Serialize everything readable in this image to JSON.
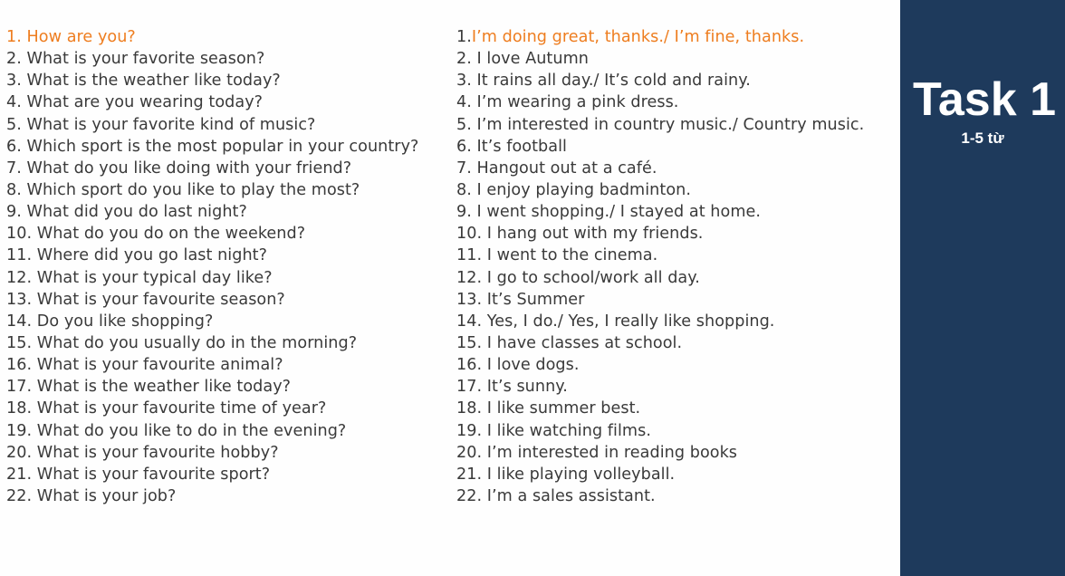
{
  "colors": {
    "highlight": "#ee7d1f",
    "text": "#3a3a3a",
    "panel": "#1e3a5c"
  },
  "panel": {
    "title": "Task 1",
    "subtitle": "1-5 từ"
  },
  "qa": [
    {
      "q": "1. How are you?",
      "a_num": "1.",
      "a": "I’m doing great, thanks./ I’m fine, thanks."
    },
    {
      "q": "2. What is your favorite season?",
      "a_num": "2. ",
      "a": "I love Autumn"
    },
    {
      "q": "3. What is the weather like today?",
      "a_num": "3. ",
      "a": "It rains all day./ It’s cold and rainy."
    },
    {
      "q": "4. What are you wearing today?",
      "a_num": "4. ",
      "a": "I’m wearing a pink dress."
    },
    {
      "q": "5. What is your favorite kind of music?",
      "a_num": "5. ",
      "a": "I’m interested in country music./ Country music."
    },
    {
      "q": "6. Which sport is the most popular in your country?",
      "a_num": "6. ",
      "a": "It’s football"
    },
    {
      "q": "7. What do you like doing with your friend?",
      "a_num": "7. ",
      "a": "Hangout out at a café."
    },
    {
      "q": "8. Which sport do you like to play the most?",
      "a_num": "8. ",
      "a": "I enjoy playing badminton."
    },
    {
      "q": "9. What did you do last night?",
      "a_num": "9. ",
      "a": "I went shopping./ I stayed at home."
    },
    {
      "q": "10. What do you do on the weekend?",
      "a_num": "10. ",
      "a": "I hang out with my friends."
    },
    {
      "q": "11. Where did you go last night?",
      "a_num": "11. ",
      "a": "I went to the cinema."
    },
    {
      "q": "12. What is your typical day like?",
      "a_num": "12. ",
      "a": "I go to school/work all day."
    },
    {
      "q": "13. What is your favourite season?",
      "a_num": "13. ",
      "a": "It’s Summer"
    },
    {
      "q": "14. Do you like shopping?",
      "a_num": "14. ",
      "a": "Yes, I do./ Yes, I really like shopping."
    },
    {
      "q": "15. What do you usually do in the morning?",
      "a_num": "15. ",
      "a": "I have classes at school."
    },
    {
      "q": "16. What is your favourite animal?",
      "a_num": "16. ",
      "a": "I love dogs."
    },
    {
      "q": "17. What is the weather like today?",
      "a_num": "17. ",
      "a": "It’s sunny."
    },
    {
      "q": "18. What is your favourite time of year?",
      "a_num": "18. ",
      "a": "I like summer best."
    },
    {
      "q": "19. What do you like to do in the evening?",
      "a_num": "19. ",
      "a": "I like watching films."
    },
    {
      "q": "20. What is your favourite hobby?",
      "a_num": "20. ",
      "a": "I’m interested in reading books"
    },
    {
      "q": "21. What is your favourite sport?",
      "a_num": "21. ",
      "a": "I like playing volleyball."
    },
    {
      "q": "22. What is your job?",
      "a_num": "22. ",
      "a": "I’m a sales assistant."
    }
  ]
}
